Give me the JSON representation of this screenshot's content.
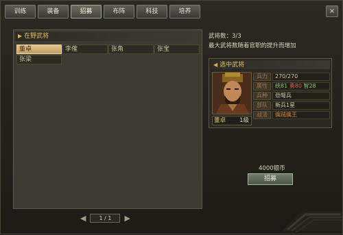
{
  "tabs": [
    "训练",
    "装备",
    "招募",
    "布阵",
    "科技",
    "培养"
  ],
  "active_tab_index": 2,
  "close_label": "×",
  "left_panel": {
    "title": "在野武将",
    "generals": [
      {
        "name": "董卓",
        "selected": true
      },
      {
        "name": "李傕",
        "selected": false
      },
      {
        "name": "张角",
        "selected": false
      },
      {
        "name": "张宝",
        "selected": false
      },
      {
        "name": "张梁",
        "selected": false
      }
    ],
    "page": "1 / 1"
  },
  "info": {
    "count_line": "武将数：3/3",
    "note_line": "最大武将数随着官职的提升而增加"
  },
  "detail": {
    "title": "选中武将",
    "name": "董卓",
    "level": "1级",
    "stats": [
      {
        "label": "兵力",
        "value": "270/270"
      },
      {
        "label": "属性",
        "parts": [
          {
            "text": "统81",
            "color": "green"
          },
          {
            "text": "勇80",
            "color": "red"
          },
          {
            "text": "智28",
            "color": "green"
          }
        ]
      },
      {
        "label": "兵种",
        "value": "劲弩兵"
      },
      {
        "label": "部队",
        "value": "新兵1星"
      },
      {
        "label": "战法",
        "value": "擒贼擒王",
        "color": "orange"
      }
    ]
  },
  "recruit": {
    "cost": "4000银币",
    "button": "招募"
  },
  "colors": {
    "accent_gold": "#e2c070",
    "selected_bg": "#e0c28a",
    "stat_red": "#e06040",
    "stat_green": "#8ac070",
    "tactic_orange": "#d08a40"
  }
}
